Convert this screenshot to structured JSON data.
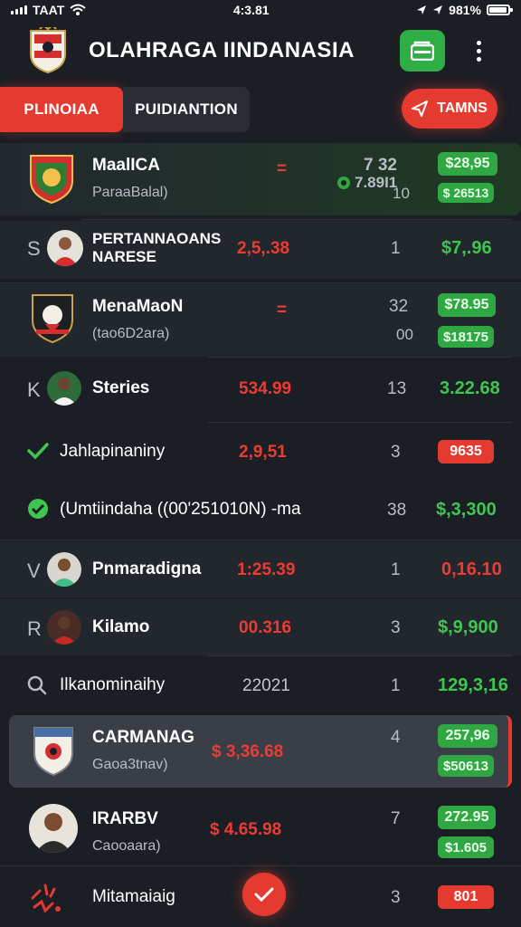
{
  "status_bar": {
    "carrier": "TAAT",
    "time": "4:3.81",
    "battery": "981%",
    "battery_level": 0.95
  },
  "header": {
    "title": "OLAHRAGA IINDANASIA",
    "wallet_icon": "wallet-icon",
    "more_icon": "more-vertical-icon"
  },
  "tabs": [
    {
      "label": "PLINOIAA",
      "active": true
    },
    {
      "label": "PUIDIANTION",
      "active": false
    }
  ],
  "action_button": {
    "label": "TAMNS",
    "icon": "send-icon"
  },
  "rows": [
    {
      "lead": "",
      "name": "MaalICA",
      "sub": "ParaaBalal)",
      "odds": "=",
      "odds_color": "red",
      "num": "7  32",
      "num2": "7.89I1",
      "num3": "10",
      "pill1": "$28,95",
      "pill2": "$ 26513"
    },
    {
      "lead": "S",
      "name": "PERTANNAOANS NARESE",
      "sub": "",
      "odds": "2,5,.38",
      "odds_color": "red",
      "num": "1",
      "price": "$7,.96",
      "price_color": "green"
    },
    {
      "lead": "",
      "name": "MenaMaoN",
      "sub": "(tao6D2ara)",
      "odds": "=",
      "odds_color": "red",
      "num": "32",
      "num3": "00",
      "pill1": "$78.95",
      "pill2": "$18175"
    },
    {
      "lead": "K",
      "name": "Steries",
      "sub": "",
      "odds": "534.99",
      "odds_color": "red",
      "num": "13",
      "price": "3.22.68",
      "price_color": "green"
    },
    {
      "lead": "",
      "name": "Jahlapinaniny",
      "sub": "",
      "odds": "2,9,51",
      "odds_color": "red",
      "num": "3",
      "pill_r": "9635"
    },
    {
      "lead": "",
      "name": "(Umtiindaha ((00'251010N) -ma",
      "sub": "",
      "odds": "",
      "num": "38",
      "price": "$,3,300",
      "price_color": "green"
    },
    {
      "lead": "V",
      "name": "Pnmaradigna",
      "sub": "",
      "odds": "1:25.39",
      "odds_color": "red",
      "num": "1",
      "price": "0,16.10",
      "price_color": "red"
    },
    {
      "lead": "R",
      "name": "Kilamo",
      "sub": "",
      "odds": "00.316",
      "odds_color": "red",
      "num": "3",
      "price": "$,9,900",
      "price_color": "green"
    },
    {
      "lead": "Q",
      "name": "Ilkanominaihy",
      "sub": "",
      "odds": "22021",
      "odds_color": "grey",
      "num": "1",
      "price": "129,3,16",
      "price_color": "green"
    },
    {
      "lead": "",
      "name": "CARMANAG",
      "sub": "Gaoa3tnav)",
      "odds": "$ 3,36.68",
      "odds_color": "red",
      "num": "4",
      "pill1": "257,96",
      "pill2": "$50613"
    },
    {
      "lead": "",
      "name": "IRARBV",
      "sub": "Caooaara)",
      "odds": "$ 4.65.98",
      "odds_color": "red",
      "num": "7",
      "pill1": "272.95",
      "pill2": "$1.605"
    },
    {
      "lead": "",
      "name": "Mitamaiaig",
      "sub": "",
      "odds": "",
      "num": "3",
      "pill_r": "801"
    }
  ],
  "colors": {
    "accent": "#e53a2f",
    "positive": "#2fa843",
    "background": "#1b1e24"
  }
}
